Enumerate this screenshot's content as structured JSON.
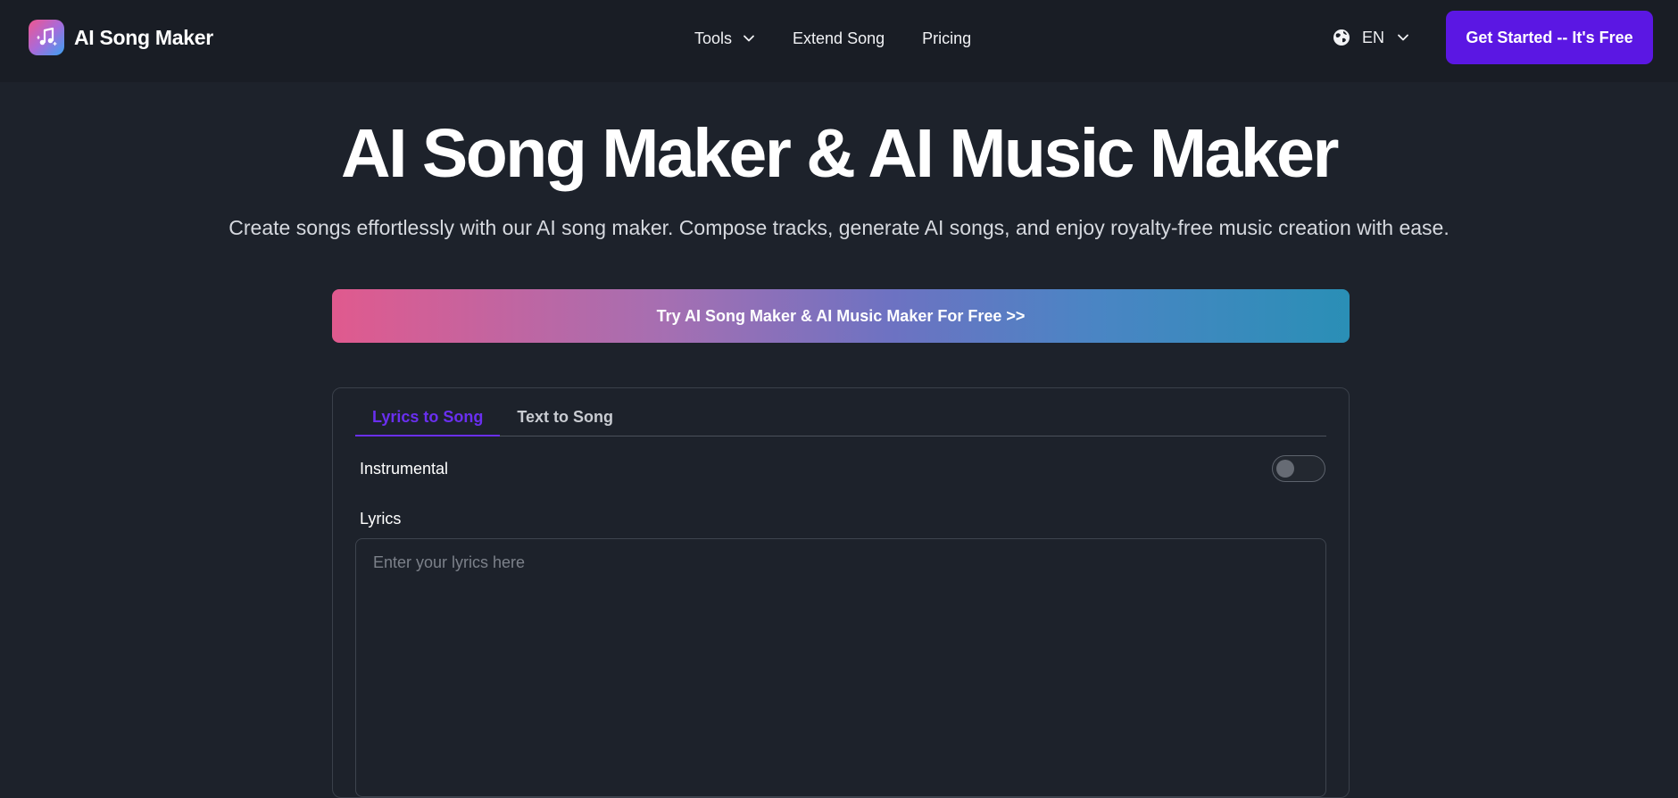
{
  "header": {
    "brand_name": "AI Song Maker",
    "logo_icon": "music-note-icon",
    "nav": [
      {
        "label": "Tools",
        "has_dropdown": true
      },
      {
        "label": "Extend Song",
        "has_dropdown": false
      },
      {
        "label": "Pricing",
        "has_dropdown": false
      }
    ],
    "language": {
      "label": "EN",
      "icon": "globe-icon"
    },
    "cta_label": "Get Started -- It's Free"
  },
  "hero": {
    "title": "AI Song Maker & AI Music Maker",
    "subtitle": "Create songs effortlessly with our AI song maker. Compose tracks, generate AI songs, and enjoy royalty-free music creation with ease.",
    "try_label": "Try AI Song Maker & AI Music Maker For Free >>"
  },
  "form": {
    "tabs": [
      {
        "label": "Lyrics to Song",
        "active": true
      },
      {
        "label": "Text to Song",
        "active": false
      }
    ],
    "instrumental_label": "Instrumental",
    "instrumental_on": false,
    "lyrics_label": "Lyrics",
    "lyrics_value": "",
    "lyrics_placeholder": "Enter your lyrics here"
  },
  "colors": {
    "page_bg": "#1d222b",
    "header_bg": "#191d25",
    "accent": "#5b17e3",
    "active_tab": "#6a2ff0"
  }
}
